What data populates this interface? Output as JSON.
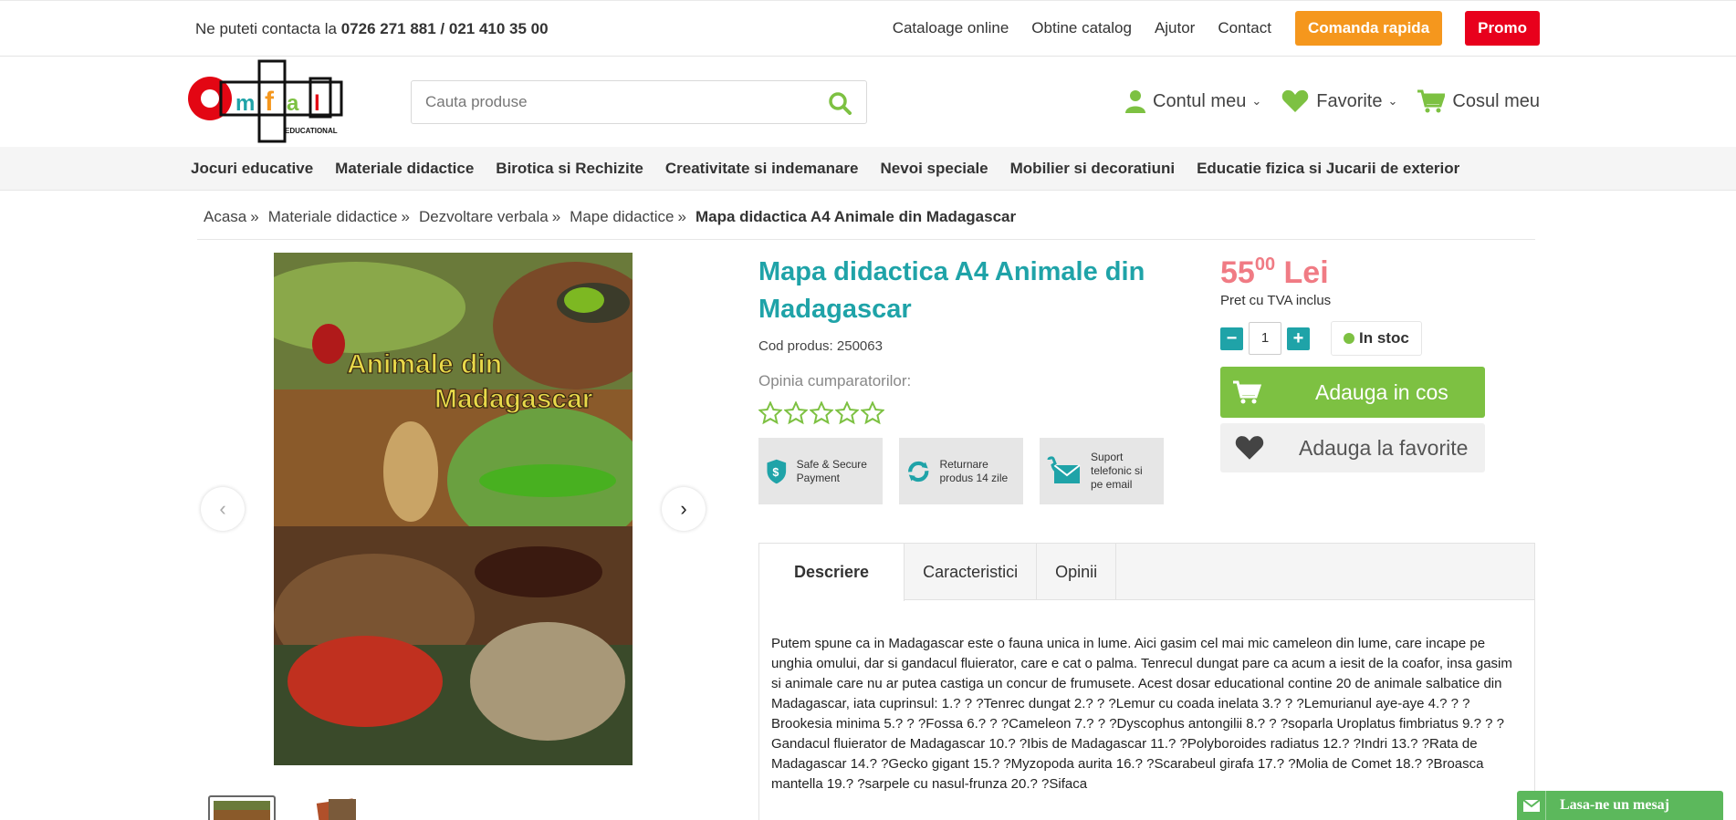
{
  "topbar": {
    "contact_prefix": "Ne puteti contacta la",
    "contact_phones": "0726 271 881 / 021 410 35 00",
    "links": [
      "Cataloage online",
      "Obtine catalog",
      "Ajutor",
      "Contact"
    ],
    "quick_order": "Comanda rapida",
    "promo": "Promo"
  },
  "header": {
    "logo_text": "omfal",
    "logo_subtext": "EDUCATIONAL",
    "search_placeholder": "Cauta produse",
    "account": "Contul meu",
    "favorites": "Favorite",
    "cart": "Cosul meu"
  },
  "nav": {
    "items": [
      "Jocuri educative",
      "Materiale didactice",
      "Birotica si Rechizite",
      "Creativitate si indemanare",
      "Nevoi speciale",
      "Mobilier si decoratiuni",
      "Educatie fizica si Jucarii de exterior"
    ]
  },
  "breadcrumb": {
    "items": [
      "Acasa",
      "Materiale didactice",
      "Dezvoltare verbala",
      "Mape didactice"
    ],
    "current": "Mapa didactica A4 Animale din Madagascar"
  },
  "product": {
    "image_title_line1": "Animale din",
    "image_title_line2": "Madagascar",
    "title": "Mapa didactica A4 Animale din Madagascar",
    "code": "Cod produs: 250063",
    "opinion_label": "Opinia cumparatorilor:",
    "rating": 0,
    "rating_max": 5,
    "badges": [
      {
        "icon": "shield-dollar-icon",
        "text": "Safe & Secure Payment"
      },
      {
        "icon": "refresh-icon",
        "text": "Returnare produs 14 zile"
      },
      {
        "icon": "phone-email-icon",
        "text": "Suport telefonic si pe email"
      }
    ]
  },
  "pricebox": {
    "price_int": "55",
    "price_dec": "00",
    "currency": "Lei",
    "vat": "Pret cu TVA inclus",
    "qty": "1",
    "stock": "In stoc",
    "add_to_cart": "Adauga in cos",
    "add_to_favorites": "Adauga la favorite"
  },
  "tabs": {
    "items": [
      "Descriere",
      "Caracteristici",
      "Opinii"
    ],
    "active": "Descriere",
    "description": "Putem spune ca in Madagascar este o fauna unica in lume. Aici gasim cel mai mic cameleon din lume, care incape pe unghia omului, dar si gandacul fluierator, care e cat o palma. Tenrecul dungat pare ca acum a iesit de la coafor, insa gasim si animale care nu ar putea castiga un concur de frumusete. Acest dosar educational contine 20 de animale salbatice din Madagascar, iata cuprinsul: 1.? ? ?Tenrec dungat 2.? ? ?Lemur cu coada inelata 3.? ? ?Lemurianul aye-aye 4.? ? ?Brookesia minima 5.? ? ?Fossa 6.? ? ?Cameleon 7.? ? ?Dyscophus antongilii 8.? ? ?soparla Uroplatus fimbriatus 9.? ? ?Gandacul fluierator de Madagascar 10.? ?Ibis de Madagascar 11.? ?Polyboroides radiatus 12.? ?Indri 13.? ?Rata de Madagascar 14.? ?Gecko gigant 15.? ?Myzopoda aurita 16.? ?Scarabeul girafa 17.? ?Molia de Comet 18.? ?Broasca mantella 19.? ?sarpele cu nasul-frunza 20.? ?Sifaca"
  },
  "chat": {
    "label": "Lasa-ne un mesaj"
  },
  "colors": {
    "teal": "#1fa3a8",
    "green": "#7dc142",
    "price": "#f07b84",
    "orange": "#f5971d",
    "red": "#e8001c"
  }
}
